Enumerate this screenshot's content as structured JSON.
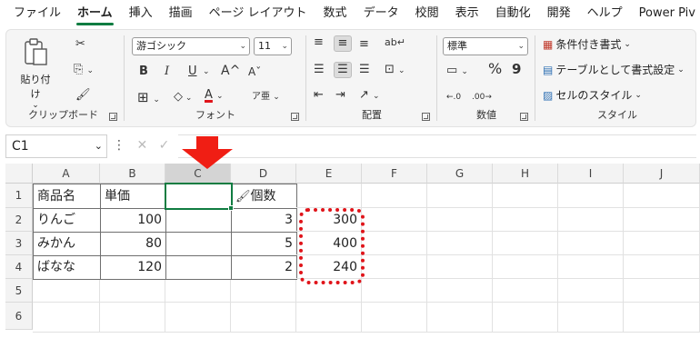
{
  "menu": {
    "tabs": [
      "ファイル",
      "ホーム",
      "挿入",
      "描画",
      "ページ レイアウト",
      "数式",
      "データ",
      "校閲",
      "表示",
      "自動化",
      "開発",
      "ヘルプ",
      "Power Piv"
    ],
    "active_tab": "ホーム"
  },
  "ribbon": {
    "clipboard": {
      "paste_label": "貼り付け",
      "label": "クリップボード"
    },
    "font": {
      "font_name": "游ゴシック",
      "font_size": "11",
      "bold": "B",
      "italic": "I",
      "underline": "U",
      "grow": "A^",
      "shrink": "Aˇ",
      "font_color": "A",
      "label": "フォント"
    },
    "alignment": {
      "label": "配置"
    },
    "number": {
      "format": "標準",
      "percent": "%",
      "comma": "9",
      "label": "数値"
    },
    "styles": {
      "conditional": "条件付き書式",
      "table": "テーブルとして書式設定",
      "cell_styles": "セルのスタイル",
      "label": "スタイル"
    }
  },
  "formula_bar": {
    "name_box": "C1",
    "cancel": "✕",
    "enter": "✓",
    "formula": ""
  },
  "sheet": {
    "columns": [
      "A",
      "B",
      "C",
      "D",
      "E",
      "F",
      "G",
      "H",
      "I",
      "J"
    ],
    "rows": [
      "1",
      "2",
      "3",
      "4",
      "5",
      "6"
    ],
    "selected_cell": "C1",
    "cells": {
      "A1": "商品名",
      "B1": "単価",
      "C1": "",
      "D1": "個数",
      "E1": "",
      "A2": "りんご",
      "B2": "100",
      "C2": "",
      "D2": "3",
      "E2": "300",
      "A3": "みかん",
      "B3": "80",
      "C3": "",
      "D3": "5",
      "E3": "400",
      "A4": "ばなな",
      "B4": "120",
      "C4": "",
      "D4": "2",
      "E4": "240"
    }
  },
  "annotations": {
    "arrow_color": "#f01e14",
    "highlight_color": "#e0141a",
    "accent": "#107c41"
  }
}
